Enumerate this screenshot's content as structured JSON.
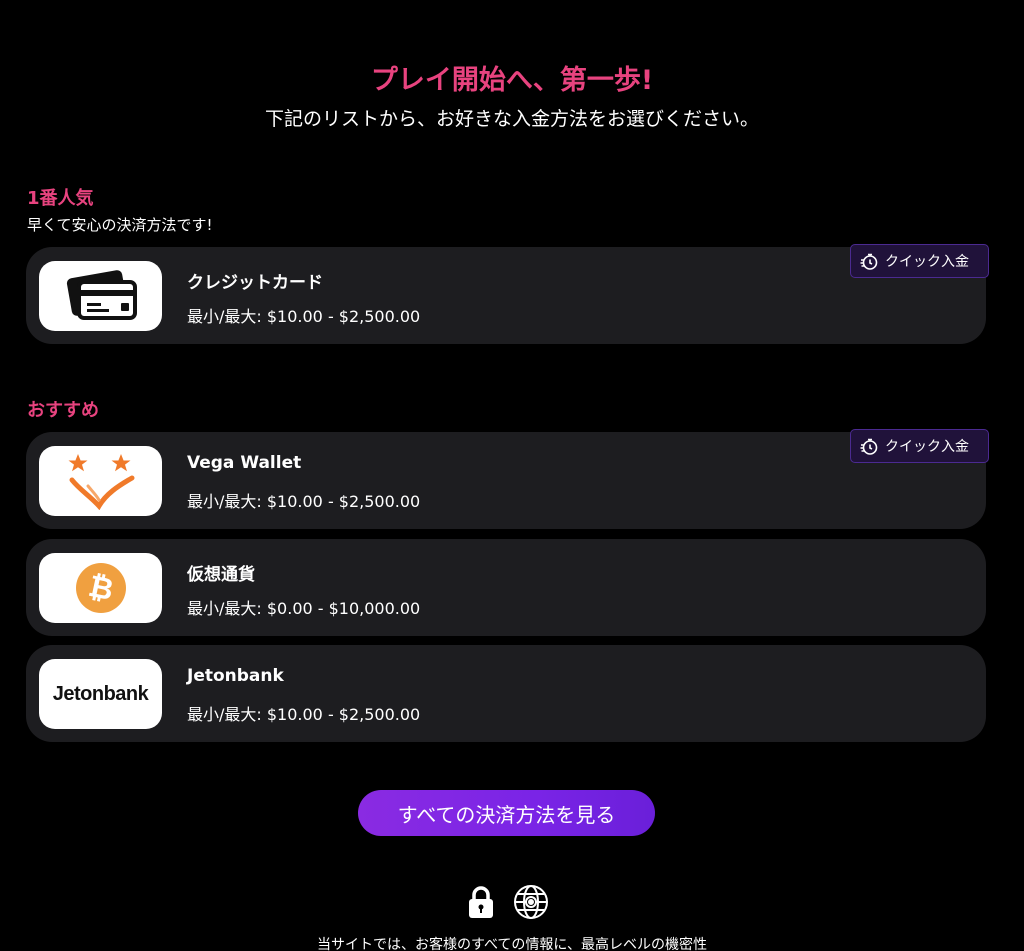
{
  "header": {
    "title": "プレイ開始へ、第一歩!",
    "subtitle": "下記のリストから、お好きな入金方法をお選びください。"
  },
  "popular": {
    "label": "1番人気",
    "description": "早くて安心の決済方法です!",
    "items": [
      {
        "name": "クレジットカード",
        "range": "最小/最大: $10.00 - $2,500.00",
        "icon": "credit-card-icon",
        "quick": "クイック入金"
      }
    ]
  },
  "recommended": {
    "label": "おすすめ",
    "items": [
      {
        "name": "Vega Wallet",
        "range": "最小/最大: $10.00 - $2,500.00",
        "icon": "vega-wallet-logo",
        "quick": "クイック入金"
      },
      {
        "name": "仮想通貨",
        "range": "最小/最大: $0.00 - $10,000.00",
        "icon": "bitcoin-icon"
      },
      {
        "name": "Jetonbank",
        "range": "最小/最大: $10.00 - $2,500.00",
        "icon": "jetonbank-logo",
        "logo_text": "Jetonbank"
      }
    ]
  },
  "cta": {
    "label": "すべての決済方法を見る"
  },
  "footer": {
    "icons": [
      "lock-icon",
      "globe-icon"
    ],
    "text": "当サイトでは、お客様のすべての情報に、最高レベルの機密性"
  },
  "colors": {
    "accent_pink": "#e8437f",
    "card_bg": "#1d1d20",
    "badge_bg": "#20123a",
    "badge_border": "#4b2a91",
    "cta_purple": "#8a2be2",
    "bitcoin_orange": "#f0a040",
    "vega_orange": "#f07a2a"
  }
}
